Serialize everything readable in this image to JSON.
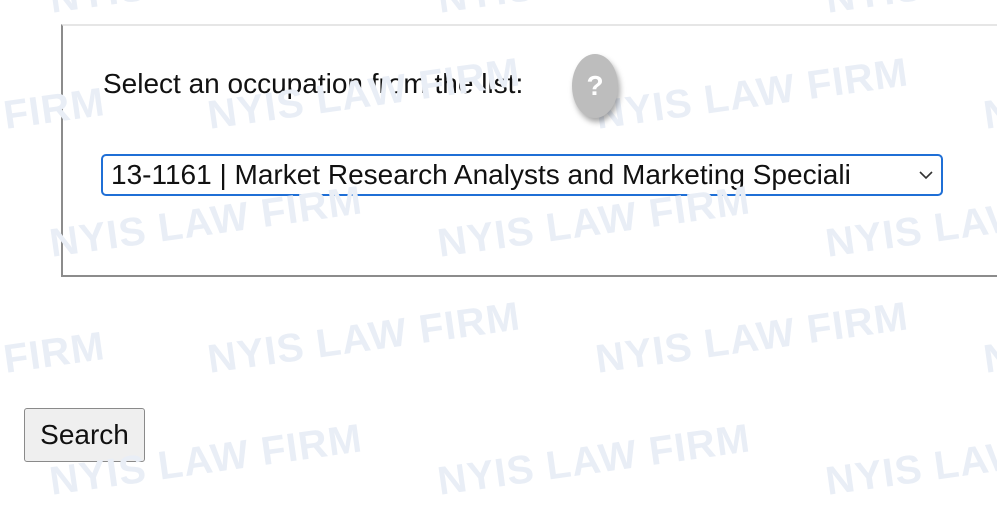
{
  "form": {
    "occupation_label": "Select an occupation from the list:",
    "help_icon_glyph": "?",
    "selected_occupation": "13-1161 | Market Research Analysts and Marketing Speciali",
    "search_label": "Search"
  },
  "watermark": {
    "text": "NYIS LAW FIRM",
    "fragment_firm": "FIRM",
    "fragment_nyis_law": "NYIS LAW",
    "fragment_n": "N",
    "color": "#e9eef6"
  },
  "colors": {
    "select_border": "#1f6fd6",
    "help_button": "#bdbdbd",
    "panel_border": "#8c8c8c"
  }
}
